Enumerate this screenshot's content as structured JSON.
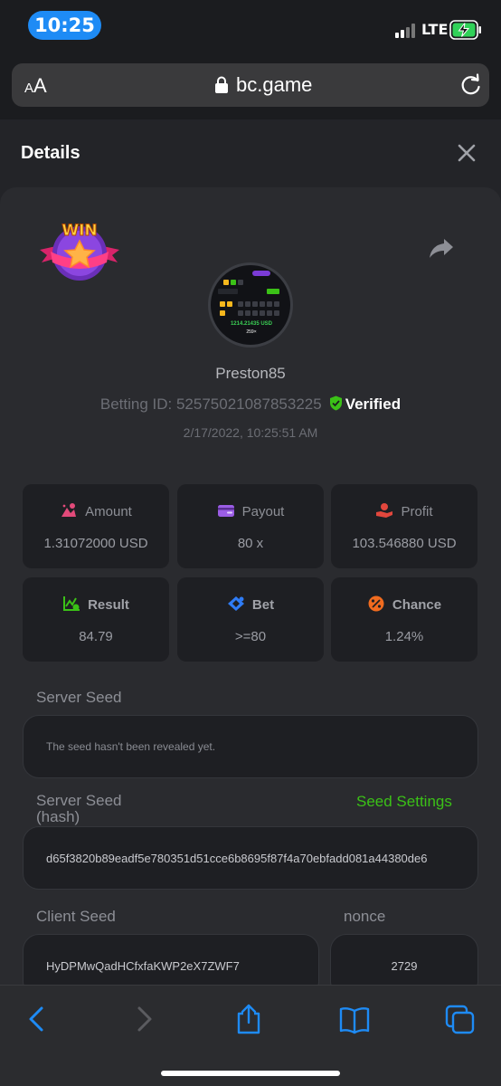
{
  "status_bar": {
    "time": "10:25",
    "network": "LTE"
  },
  "browser": {
    "text_size_label_small": "A",
    "text_size_label_large": "A",
    "domain": "bc.game"
  },
  "modal": {
    "title": "Details",
    "badge_text": "WIN",
    "avatar": {
      "value": "1214.21435 USD",
      "sub": "259×"
    },
    "username": "Preston85",
    "betting_id_label": "Betting ID:",
    "betting_id": "52575021087853225",
    "verified_label": "Verified",
    "datetime": "2/17/2022, 10:25:51 AM",
    "stats": [
      {
        "label": "Amount",
        "value": "1.31072000 USD",
        "icon": "amount-icon",
        "color": "#e34a7a"
      },
      {
        "label": "Payout",
        "value": "80 x",
        "icon": "wallet-icon",
        "color": "#9b5de5"
      },
      {
        "label": "Profit",
        "value": "103.546880 USD",
        "icon": "profit-icon",
        "color": "#e2473d"
      },
      {
        "label": "Result",
        "value": "84.79",
        "icon": "chart-check-icon",
        "color": "#3bc117"
      },
      {
        "label": "Bet",
        "value": ">=80",
        "icon": "diamond-icon",
        "color": "#2f7cf6"
      },
      {
        "label": "Chance",
        "value": "1.24%",
        "icon": "percent-icon",
        "color": "#f06b1f"
      }
    ],
    "server_seed": {
      "label": "Server Seed",
      "value": "The seed hasn't been revealed yet."
    },
    "server_seed_hash": {
      "label_line1": "Server Seed",
      "label_line2": "(hash)",
      "settings_link": "Seed Settings",
      "value": "d65f3820b89eadf5e780351d51cce6b8695f87f4a70ebfadd081a44380de6"
    },
    "client_seed": {
      "label": "Client Seed",
      "value": "HyDPMwQadHCfxfaKWP2eX7ZWF7"
    },
    "nonce": {
      "label": "nonce",
      "value": "2729"
    }
  },
  "colors": {
    "accent_green": "#3bc117",
    "time_pill": "#1e8bf5",
    "safari_blue": "#1e8bf5"
  }
}
